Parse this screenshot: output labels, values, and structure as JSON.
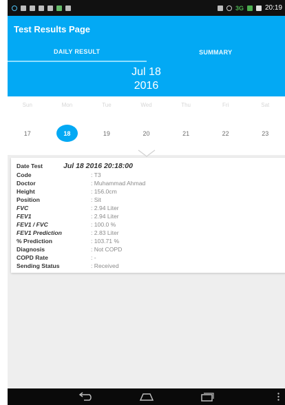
{
  "status_bar": {
    "network": "3G",
    "time": "20:19"
  },
  "app_bar": {
    "title": "Test Results Page"
  },
  "tabs": [
    {
      "label": "DAILY RESULT",
      "active": true
    },
    {
      "label": "SUMMARY",
      "active": false
    }
  ],
  "date_header": {
    "month_day": "Jul 18",
    "year": "2016"
  },
  "week": {
    "day_names": [
      "Sun",
      "Mon",
      "Tue",
      "Wed",
      "Thu",
      "Fri",
      "Sat"
    ],
    "day_numbers": [
      "17",
      "18",
      "19",
      "20",
      "21",
      "22",
      "23"
    ],
    "selected_index": 1
  },
  "result": {
    "date_label": "Date Test",
    "date_value": "Jul 18 2016 20:18:00",
    "fields": [
      {
        "label": "Code",
        "value": ": T3",
        "italic": false
      },
      {
        "label": "Doctor",
        "value": ": Muhammad  Ahmad",
        "italic": false
      },
      {
        "label": "Height",
        "value": ": 156.0cm",
        "italic": false
      },
      {
        "label": "Position",
        "value": ": Sit",
        "italic": false
      },
      {
        "label": "FVC",
        "value": ": 2.94 Liter",
        "italic": true
      },
      {
        "label": "FEV1",
        "value": ": 2.94 Liter",
        "italic": true
      },
      {
        "label": "FEV1 / FVC",
        "value": ": 100.0 %",
        "italic": true
      },
      {
        "label": "FEV1 Prediction",
        "value": ": 2.83 Liter",
        "italic": true
      },
      {
        "label": "% Prediction",
        "value": ": 103.71 %",
        "italic": false
      },
      {
        "label": "Diagnosis",
        "value": ": Not COPD",
        "italic": false
      },
      {
        "label": "COPD Rate",
        "value": ": -",
        "italic": false
      },
      {
        "label": "Sending Status",
        "value": ": Received",
        "italic": false
      }
    ]
  },
  "colors": {
    "accent": "#03a9f4",
    "status_bar": "#111111",
    "nav_bar": "#0a0a0a"
  },
  "icons": [
    "back-icon",
    "home-icon",
    "recents-icon",
    "overflow-menu-icon",
    "chevron-down-icon"
  ]
}
